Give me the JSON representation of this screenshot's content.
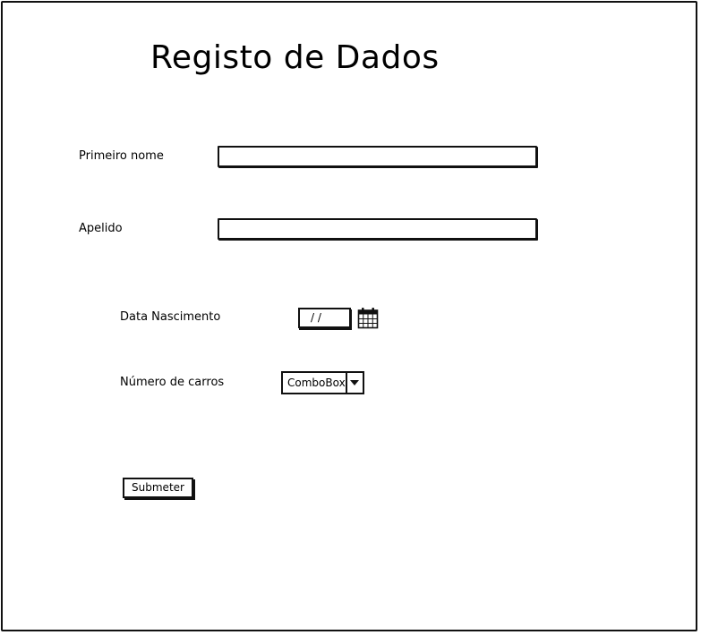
{
  "form": {
    "title": "Registo de Dados",
    "first_name": {
      "label": "Primeiro nome",
      "value": ""
    },
    "last_name": {
      "label": "Apelido",
      "value": ""
    },
    "birth_date": {
      "label": "Data Nascimento",
      "value": "/ /"
    },
    "car_count": {
      "label": "Número de carros",
      "value": "ComboBox"
    },
    "submit_label": "Submeter"
  },
  "icons": {
    "calendar": "calendar-icon",
    "dropdown": "chevron-down-icon"
  }
}
